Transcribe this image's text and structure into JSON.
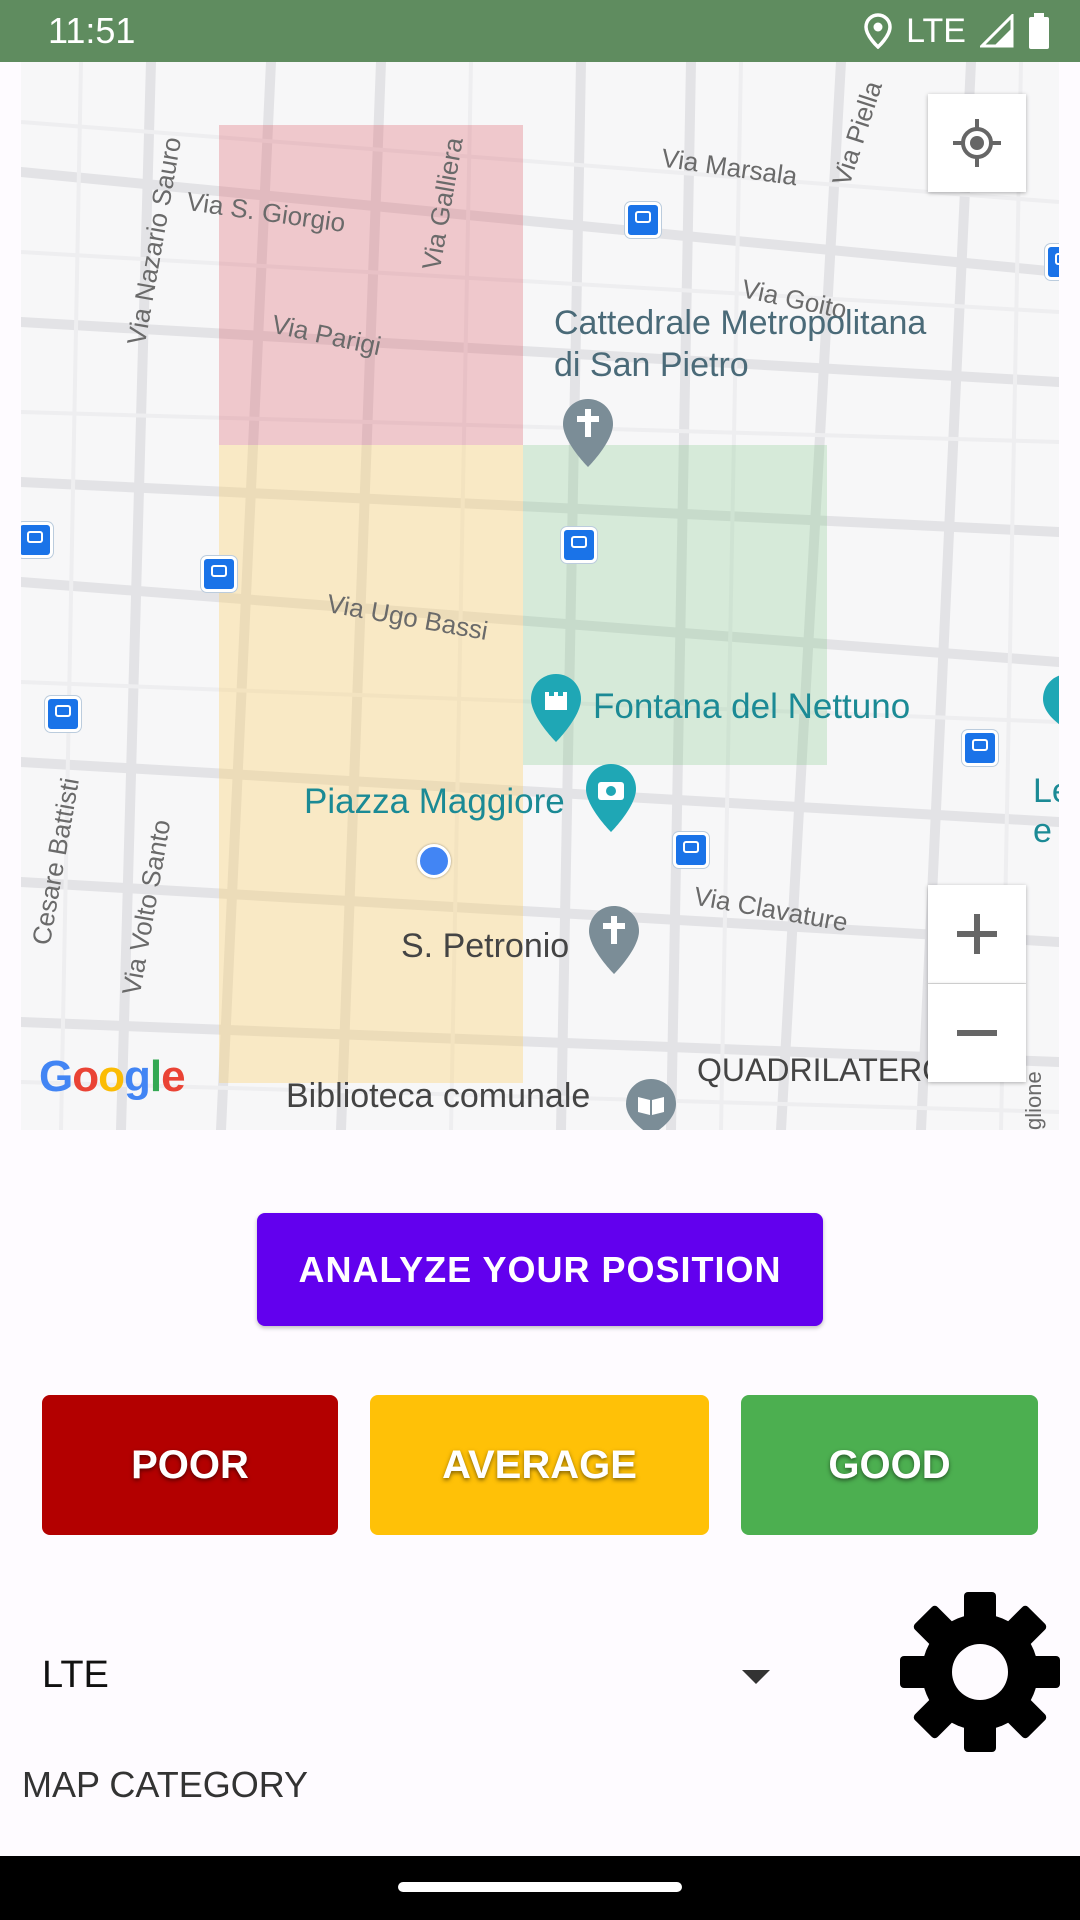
{
  "status_bar": {
    "time": "11:51",
    "network": "LTE"
  },
  "map": {
    "streets": [
      "Via S. Giorgio",
      "Via Galliera",
      "Via Parigi",
      "Via Nazario Sauro",
      "Via Marsala",
      "Via Piella",
      "Via Goito",
      "Via Ugo Bassi",
      "Via Clavature",
      "Via Volto Santo",
      "Cesare Battisti"
    ],
    "pois": {
      "cattedrale": "Cattedrale Metropolitana\ndi San Pietro",
      "fontana": "Fontana del Nettuno",
      "piazza": "Piazza Maggiore",
      "petronio": "S. Petronio",
      "biblioteca": "Biblioteca comunale",
      "quadrilatero": "QUADRILATERO",
      "edge_le": "Le",
      "edge_e": "e",
      "edge_glione": "glione"
    },
    "google_logo": "Google",
    "zoom_in": "+",
    "zoom_out": "−"
  },
  "analyze_button": "ANALYZE YOUR POSITION",
  "categories": {
    "poor": "POOR",
    "average": "AVERAGE",
    "good": "GOOD"
  },
  "network_select": {
    "value": "LTE"
  },
  "map_category_label": "MAP CATEGORY",
  "colors": {
    "poor": "#b30000",
    "average": "#ffc107",
    "good": "#4caf50",
    "primary": "#6200ee"
  }
}
